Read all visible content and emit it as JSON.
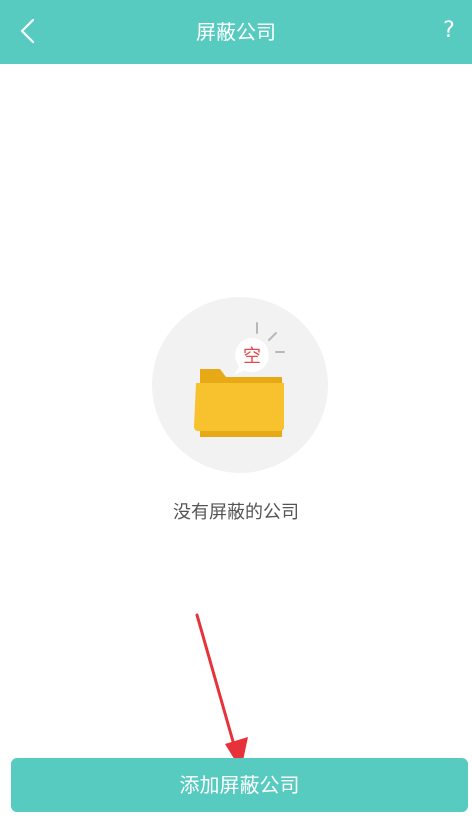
{
  "header": {
    "title": "屏蔽公司",
    "back_icon": "chevron-left-icon",
    "help_label": "?",
    "background_color": "#58CBC1"
  },
  "empty_state": {
    "icon": "empty-folder-icon",
    "badge_text": "空",
    "message": "没有屏蔽的公司"
  },
  "footer": {
    "add_button_label": "添加屏蔽公司",
    "button_color": "#58CBC1"
  },
  "annotation": {
    "arrow_color": "#E8323A"
  }
}
